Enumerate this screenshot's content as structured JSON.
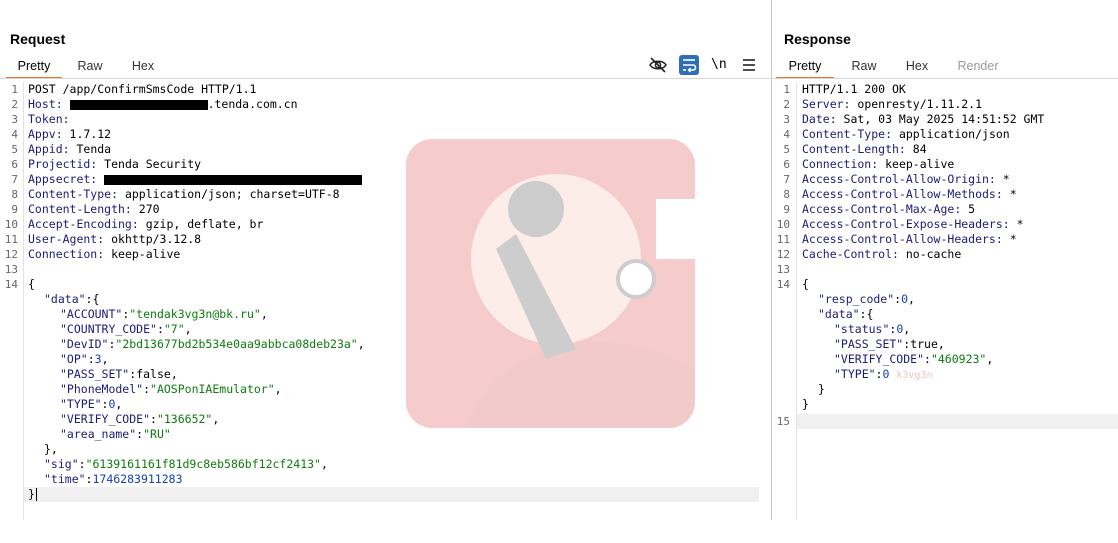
{
  "request": {
    "title": "Request",
    "tabs": [
      "Pretty",
      "Raw",
      "Hex"
    ],
    "active_tab": "Pretty",
    "toolbar": {
      "hide_icon": "eye-off-icon",
      "wrap_icon": "word-wrap-icon",
      "newline_label": "\\n",
      "menu_icon": "hamburger-menu-icon"
    },
    "line_numbers": [
      "1",
      "2",
      "3",
      "4",
      "5",
      "6",
      "7",
      "8",
      "9",
      "10",
      "11",
      "12",
      "13",
      "14"
    ],
    "lines": {
      "l1": "POST /app/ConfirmSmsCode HTTP/1.1",
      "l2_key": "Host:",
      "l2_val": ".tenda.com.cn",
      "l3_key": "Token:",
      "l4_key": "Appv:",
      "l4_val": " 1.7.12",
      "l5_key": "Appid:",
      "l5_val": " Tenda",
      "l6_key": "Projectid:",
      "l6_val": " Tenda Security",
      "l7_key": "Appsecret:",
      "l8_key": "Content-Type:",
      "l8_val": " application/json; charset=UTF-8",
      "l9_key": "Content-Length:",
      "l9_val": " 270",
      "l10_key": "Accept-Encoding:",
      "l10_val": " gzip, deflate, br",
      "l11_key": "User-Agent:",
      "l11_val": " okhttp/3.12.8",
      "l12_key": "Connection:",
      "l12_val": " keep-alive"
    },
    "body": {
      "open": "{",
      "data_key": "\"data\"",
      "data_open": ":{",
      "account_key": "\"ACCOUNT\"",
      "account_val": "\"tendak3vg3n@bk.ru\"",
      "country_key": "\"COUNTRY_CODE\"",
      "country_val": "\"7\"",
      "devid_key": "\"DevID\"",
      "devid_val": "\"2bd13677bd2b534e0aa9abbca08deb23a\"",
      "op_key": "\"OP\"",
      "op_val": "3",
      "pass_key": "\"PASS_SET\"",
      "pass_val": "false",
      "phone_key": "\"PhoneModel\"",
      "phone_val": "\"AOSPonIAEmulator\"",
      "type_key": "\"TYPE\"",
      "type_val": "0",
      "verify_key": "\"VERIFY_CODE\"",
      "verify_val": "\"136652\"",
      "area_key": "\"area_name\"",
      "area_val": "\"RU\"",
      "data_close": "},",
      "sig_key": "\"sig\"",
      "sig_val": "\"6139161161f81d9c8eb586bf12cf2413\"",
      "time_key": "\"time\"",
      "time_val": "1746283911283",
      "close": "}"
    }
  },
  "response": {
    "title": "Response",
    "tabs": [
      "Pretty",
      "Raw",
      "Hex",
      "Render"
    ],
    "active_tab": "Pretty",
    "line_numbers": [
      "1",
      "2",
      "3",
      "4",
      "5",
      "6",
      "7",
      "8",
      "9",
      "10",
      "11",
      "12",
      "13",
      "14",
      "15"
    ],
    "lines": {
      "l1": "HTTP/1.1 200 OK",
      "l2_key": "Server:",
      "l2_val": " openresty/1.11.2.1",
      "l3_key": "Date:",
      "l3_val": " Sat, 03 May 2025 14:51:52 GMT",
      "l4_key": "Content-Type:",
      "l4_val": " application/json",
      "l5_key": "Content-Length:",
      "l5_val": " 84",
      "l6_key": "Connection:",
      "l6_val": " keep-alive",
      "l7_key": "Access-Control-Allow-Origin:",
      "l7_val": " *",
      "l8_key": "Access-Control-Allow-Methods:",
      "l8_val": " *",
      "l9_key": "Access-Control-Max-Age:",
      "l9_val": " 5",
      "l10_key": "Access-Control-Expose-Headers:",
      "l10_val": " *",
      "l11_key": "Access-Control-Allow-Headers:",
      "l11_val": " *",
      "l12_key": "Cache-Control:",
      "l12_val": " no-cache"
    },
    "body": {
      "open": "{",
      "resp_key": "\"resp_code\"",
      "resp_val": "0",
      "data_key": "\"data\"",
      "data_open": ":{",
      "status_key": "\"status\"",
      "status_val": "0",
      "pass_key": "\"PASS_SET\"",
      "pass_val": "true",
      "verify_key": "\"VERIFY_CODE\"",
      "verify_val": "\"460923\"",
      "type_key": "\"TYPE\"",
      "type_val": "0",
      "watermark_text": "k3vg3n",
      "data_close": "}",
      "close": "}"
    }
  },
  "colors": {
    "accent_tab": "#e8762c",
    "key": "#1b1b7a",
    "string": "#0e7a0e",
    "number": "#0e3fb8",
    "wrap_icon_bg": "#2f6fb5"
  }
}
